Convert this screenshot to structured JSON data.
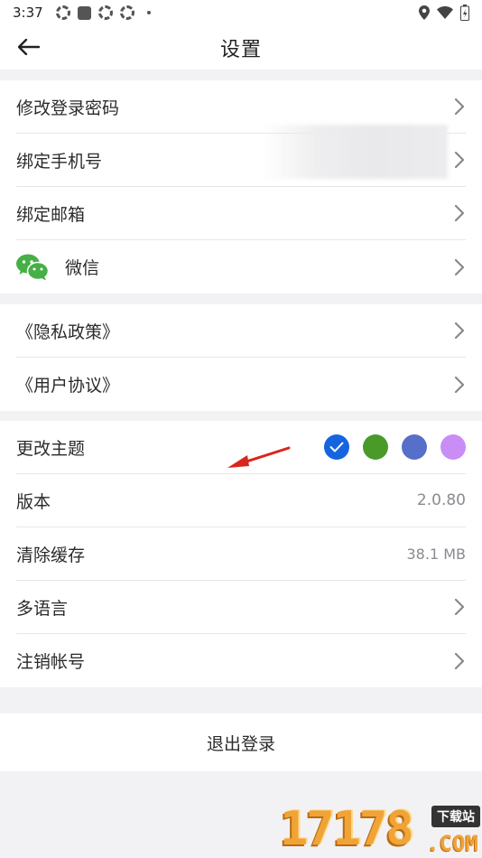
{
  "status_bar": {
    "time": "3:37"
  },
  "nav": {
    "title": "设置"
  },
  "group1": {
    "items": [
      {
        "label": "修改登录密码"
      },
      {
        "label": "绑定手机号"
      },
      {
        "label": "绑定邮箱"
      },
      {
        "label": "微信"
      }
    ]
  },
  "group2": {
    "items": [
      {
        "label": "《隐私政策》"
      },
      {
        "label": "《用户协议》"
      }
    ]
  },
  "group3": {
    "theme": {
      "label": "更改主题",
      "colors": [
        "#1565e0",
        "#4a9a2a",
        "#5670c9",
        "#c98df5"
      ],
      "selected_index": 0
    },
    "version": {
      "label": "版本",
      "value": "2.0.80"
    },
    "cache": {
      "label": "清除缓存",
      "value": "38.1 MB"
    },
    "language": {
      "label": "多语言"
    },
    "delete_account": {
      "label": "注销帐号"
    }
  },
  "logout": {
    "label": "退出登录"
  },
  "watermark": {
    "number": "17178",
    "tag": "下载站",
    "domain": ".COM"
  }
}
